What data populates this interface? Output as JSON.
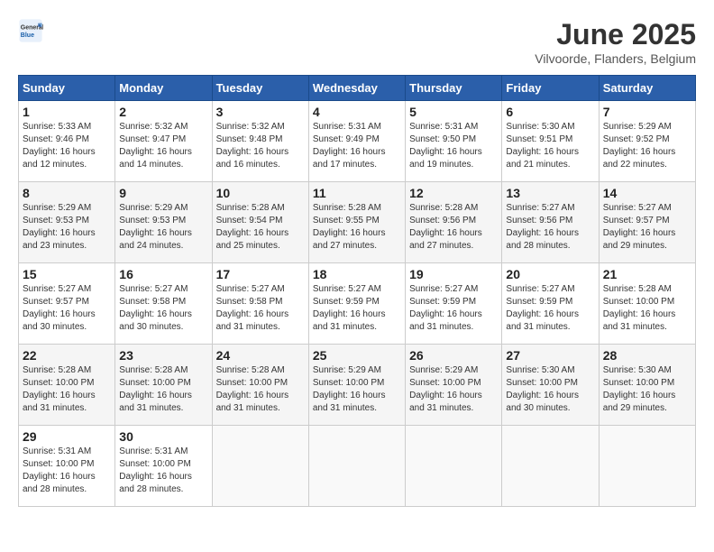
{
  "header": {
    "logo_general": "General",
    "logo_blue": "Blue",
    "month_title": "June 2025",
    "location": "Vilvoorde, Flanders, Belgium"
  },
  "days_of_week": [
    "Sunday",
    "Monday",
    "Tuesday",
    "Wednesday",
    "Thursday",
    "Friday",
    "Saturday"
  ],
  "weeks": [
    [
      {
        "day": "1",
        "sunrise": "5:33 AM",
        "sunset": "9:46 PM",
        "daylight": "16 hours and 12 minutes."
      },
      {
        "day": "2",
        "sunrise": "5:32 AM",
        "sunset": "9:47 PM",
        "daylight": "16 hours and 14 minutes."
      },
      {
        "day": "3",
        "sunrise": "5:32 AM",
        "sunset": "9:48 PM",
        "daylight": "16 hours and 16 minutes."
      },
      {
        "day": "4",
        "sunrise": "5:31 AM",
        "sunset": "9:49 PM",
        "daylight": "16 hours and 17 minutes."
      },
      {
        "day": "5",
        "sunrise": "5:31 AM",
        "sunset": "9:50 PM",
        "daylight": "16 hours and 19 minutes."
      },
      {
        "day": "6",
        "sunrise": "5:30 AM",
        "sunset": "9:51 PM",
        "daylight": "16 hours and 21 minutes."
      },
      {
        "day": "7",
        "sunrise": "5:29 AM",
        "sunset": "9:52 PM",
        "daylight": "16 hours and 22 minutes."
      }
    ],
    [
      {
        "day": "8",
        "sunrise": "5:29 AM",
        "sunset": "9:53 PM",
        "daylight": "16 hours and 23 minutes."
      },
      {
        "day": "9",
        "sunrise": "5:29 AM",
        "sunset": "9:53 PM",
        "daylight": "16 hours and 24 minutes."
      },
      {
        "day": "10",
        "sunrise": "5:28 AM",
        "sunset": "9:54 PM",
        "daylight": "16 hours and 25 minutes."
      },
      {
        "day": "11",
        "sunrise": "5:28 AM",
        "sunset": "9:55 PM",
        "daylight": "16 hours and 27 minutes."
      },
      {
        "day": "12",
        "sunrise": "5:28 AM",
        "sunset": "9:56 PM",
        "daylight": "16 hours and 27 minutes."
      },
      {
        "day": "13",
        "sunrise": "5:27 AM",
        "sunset": "9:56 PM",
        "daylight": "16 hours and 28 minutes."
      },
      {
        "day": "14",
        "sunrise": "5:27 AM",
        "sunset": "9:57 PM",
        "daylight": "16 hours and 29 minutes."
      }
    ],
    [
      {
        "day": "15",
        "sunrise": "5:27 AM",
        "sunset": "9:57 PM",
        "daylight": "16 hours and 30 minutes."
      },
      {
        "day": "16",
        "sunrise": "5:27 AM",
        "sunset": "9:58 PM",
        "daylight": "16 hours and 30 minutes."
      },
      {
        "day": "17",
        "sunrise": "5:27 AM",
        "sunset": "9:58 PM",
        "daylight": "16 hours and 31 minutes."
      },
      {
        "day": "18",
        "sunrise": "5:27 AM",
        "sunset": "9:59 PM",
        "daylight": "16 hours and 31 minutes."
      },
      {
        "day": "19",
        "sunrise": "5:27 AM",
        "sunset": "9:59 PM",
        "daylight": "16 hours and 31 minutes."
      },
      {
        "day": "20",
        "sunrise": "5:27 AM",
        "sunset": "9:59 PM",
        "daylight": "16 hours and 31 minutes."
      },
      {
        "day": "21",
        "sunrise": "5:28 AM",
        "sunset": "10:00 PM",
        "daylight": "16 hours and 31 minutes."
      }
    ],
    [
      {
        "day": "22",
        "sunrise": "5:28 AM",
        "sunset": "10:00 PM",
        "daylight": "16 hours and 31 minutes."
      },
      {
        "day": "23",
        "sunrise": "5:28 AM",
        "sunset": "10:00 PM",
        "daylight": "16 hours and 31 minutes."
      },
      {
        "day": "24",
        "sunrise": "5:28 AM",
        "sunset": "10:00 PM",
        "daylight": "16 hours and 31 minutes."
      },
      {
        "day": "25",
        "sunrise": "5:29 AM",
        "sunset": "10:00 PM",
        "daylight": "16 hours and 31 minutes."
      },
      {
        "day": "26",
        "sunrise": "5:29 AM",
        "sunset": "10:00 PM",
        "daylight": "16 hours and 31 minutes."
      },
      {
        "day": "27",
        "sunrise": "5:30 AM",
        "sunset": "10:00 PM",
        "daylight": "16 hours and 30 minutes."
      },
      {
        "day": "28",
        "sunrise": "5:30 AM",
        "sunset": "10:00 PM",
        "daylight": "16 hours and 29 minutes."
      }
    ],
    [
      {
        "day": "29",
        "sunrise": "5:31 AM",
        "sunset": "10:00 PM",
        "daylight": "16 hours and 28 minutes."
      },
      {
        "day": "30",
        "sunrise": "5:31 AM",
        "sunset": "10:00 PM",
        "daylight": "16 hours and 28 minutes."
      },
      null,
      null,
      null,
      null,
      null
    ]
  ],
  "labels": {
    "sunrise": "Sunrise:",
    "sunset": "Sunset:",
    "daylight": "Daylight: 16 hours"
  }
}
